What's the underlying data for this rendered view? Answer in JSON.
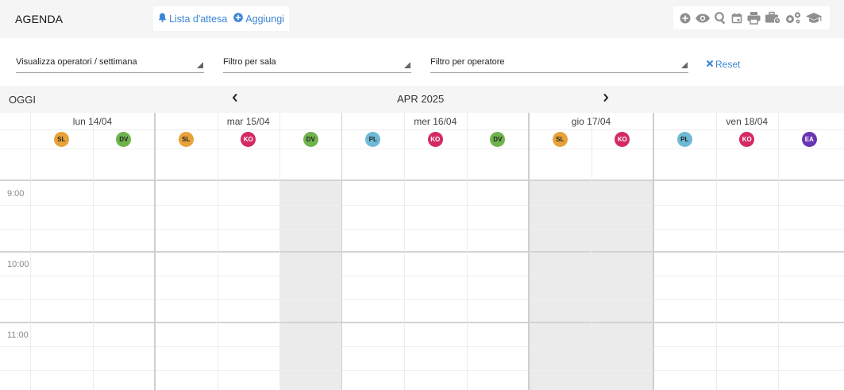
{
  "header": {
    "title": "AGENDA",
    "waitlist_label": "Lista d'attesa",
    "add_label": "Aggiungi",
    "toolbar_icons": [
      "add-circle-icon",
      "eye-icon",
      "search-icon",
      "calendar-icon",
      "print-icon",
      "briefcase-clock-icon",
      "gears-icon",
      "graduation-cap-icon"
    ]
  },
  "filters": {
    "view": "Visualizza operatori / settimana",
    "room": "Filtro per sala",
    "operator": "Filtro per operatore",
    "reset_label": "Reset"
  },
  "nav": {
    "today_label": "OGGI",
    "period_label": "APR 2025",
    "prev_icon": "chevron-left-icon",
    "next_icon": "chevron-right-icon"
  },
  "days": [
    {
      "label": "lun 14/04",
      "operators": [
        "SL",
        "DV"
      ]
    },
    {
      "label": "mar 15/04",
      "operators": [
        "SL",
        "KO",
        "DV"
      ]
    },
    {
      "label": "mer 16/04",
      "operators": [
        "PL",
        "KO",
        "DV"
      ]
    },
    {
      "label": "gio 17/04",
      "operators": [
        "SL",
        "KO"
      ]
    },
    {
      "label": "ven 18/04",
      "operators": [
        "PL",
        "KO",
        "EA"
      ]
    }
  ],
  "operator_colors": {
    "SL": "#e8a23a",
    "DV": "#6fb34d",
    "KO": "#d42a63",
    "PL": "#6ebad6",
    "EA": "#6a35b5"
  },
  "times": [
    "9:00",
    "10:00",
    "11:00"
  ],
  "colors": {
    "accent": "#3a85d6",
    "unavailable": "#ebebeb"
  }
}
